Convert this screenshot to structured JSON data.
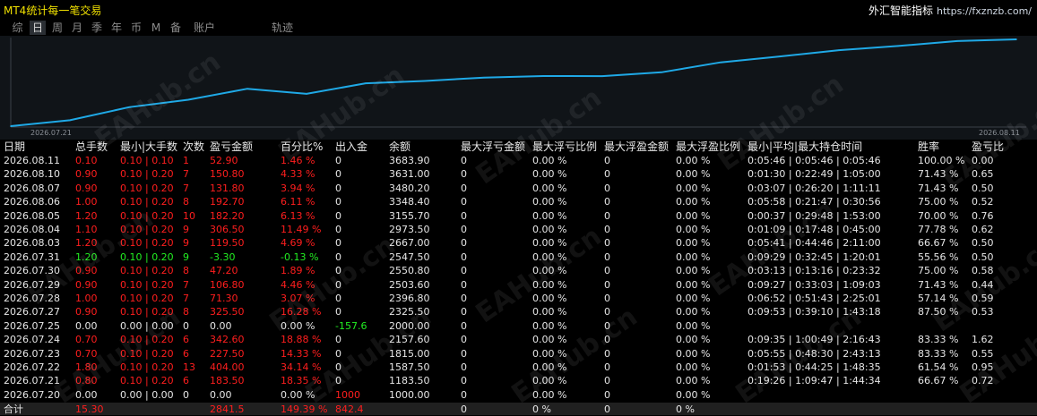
{
  "app": {
    "title": "MT4统计每一笔交易",
    "brand_name": "外汇智能指标",
    "brand_url": "https://fxznzb.com/"
  },
  "tabs": [
    {
      "label": "综",
      "active": false
    },
    {
      "label": "日",
      "active": true
    },
    {
      "label": "周",
      "active": false
    },
    {
      "label": "月",
      "active": false
    },
    {
      "label": "季",
      "active": false
    },
    {
      "label": "年",
      "active": false
    },
    {
      "label": "币",
      "active": false
    },
    {
      "label": "M",
      "active": false
    },
    {
      "label": "备",
      "active": false
    },
    {
      "label": "账户",
      "active": false
    },
    {
      "label": "轨迹",
      "active": false
    }
  ],
  "colors": {
    "loss": "#ff1e1e",
    "profit": "#22ee22",
    "neutral": "#e6e6e6",
    "line": "#1fa9e6",
    "title": "#f0e000"
  },
  "watermark": "EAHub.cn",
  "chart_data": {
    "type": "line",
    "x_start_label": "2026.07.21",
    "x_end_label": "2026.08.11",
    "series": [
      {
        "values": [
          1000.0,
          1183.5,
          1587.5,
          1815.0,
          2157.6,
          2000.0,
          2325.5,
          2396.8,
          2503.6,
          2550.8,
          2547.5,
          2667.0,
          2973.5,
          3155.7,
          3348.4,
          3480.2,
          3631.0,
          3683.9
        ]
      }
    ],
    "ylim": [
      1000.0,
      3683.9
    ]
  },
  "table": {
    "headers": [
      "日期",
      "总手数",
      "最小|大手数",
      "次数",
      "盈亏金额",
      "百分比%",
      "出入金",
      "余额",
      "最大浮亏金额",
      "最大浮亏比例",
      "最大浮盈金额",
      "最大浮盈比例",
      "最小|平均|最大持仓时间",
      "胜率",
      "盈亏比"
    ],
    "rows": [
      {
        "date": "2026.08.11",
        "lots": "0.10",
        "minmax": "0.10 | 0.10",
        "count": "1",
        "pnl": "52.90",
        "pct": "1.46 %",
        "flow": "0",
        "balance": "3683.90",
        "fl_amt": "0",
        "fl_pct": "0.00 %",
        "fp_amt": "0",
        "fp_pct": "0.00 %",
        "time": "0:05:46 | 0:05:46 | 0:05:46",
        "win": "100.00 %",
        "rr": "0.00",
        "color": "red",
        "flow_color": "white"
      },
      {
        "date": "2026.08.10",
        "lots": "0.90",
        "minmax": "0.10 | 0.20",
        "count": "7",
        "pnl": "150.80",
        "pct": "4.33 %",
        "flow": "0",
        "balance": "3631.00",
        "fl_amt": "0",
        "fl_pct": "0.00 %",
        "fp_amt": "0",
        "fp_pct": "0.00 %",
        "time": "0:01:30 | 0:22:49 | 1:05:00",
        "win": "71.43 %",
        "rr": "0.65",
        "color": "red",
        "flow_color": "white"
      },
      {
        "date": "2026.08.07",
        "lots": "0.90",
        "minmax": "0.10 | 0.20",
        "count": "7",
        "pnl": "131.80",
        "pct": "3.94 %",
        "flow": "0",
        "balance": "3480.20",
        "fl_amt": "0",
        "fl_pct": "0.00 %",
        "fp_amt": "0",
        "fp_pct": "0.00 %",
        "time": "0:03:07 | 0:26:20 | 1:11:11",
        "win": "71.43 %",
        "rr": "0.50",
        "color": "red",
        "flow_color": "white"
      },
      {
        "date": "2026.08.06",
        "lots": "1.00",
        "minmax": "0.10 | 0.20",
        "count": "8",
        "pnl": "192.70",
        "pct": "6.11 %",
        "flow": "0",
        "balance": "3348.40",
        "fl_amt": "0",
        "fl_pct": "0.00 %",
        "fp_amt": "0",
        "fp_pct": "0.00 %",
        "time": "0:05:58 | 0:21:47 | 0:30:56",
        "win": "75.00 %",
        "rr": "0.52",
        "color": "red",
        "flow_color": "white"
      },
      {
        "date": "2026.08.05",
        "lots": "1.20",
        "minmax": "0.10 | 0.20",
        "count": "10",
        "pnl": "182.20",
        "pct": "6.13 %",
        "flow": "0",
        "balance": "3155.70",
        "fl_amt": "0",
        "fl_pct": "0.00 %",
        "fp_amt": "0",
        "fp_pct": "0.00 %",
        "time": "0:00:37 | 0:29:48 | 1:53:00",
        "win": "70.00 %",
        "rr": "0.76",
        "color": "red",
        "flow_color": "white"
      },
      {
        "date": "2026.08.04",
        "lots": "1.10",
        "minmax": "0.10 | 0.20",
        "count": "9",
        "pnl": "306.50",
        "pct": "11.49 %",
        "flow": "0",
        "balance": "2973.50",
        "fl_amt": "0",
        "fl_pct": "0.00 %",
        "fp_amt": "0",
        "fp_pct": "0.00 %",
        "time": "0:01:09 | 0:17:48 | 0:45:00",
        "win": "77.78 %",
        "rr": "0.62",
        "color": "red",
        "flow_color": "white"
      },
      {
        "date": "2026.08.03",
        "lots": "1.20",
        "minmax": "0.10 | 0.20",
        "count": "9",
        "pnl": "119.50",
        "pct": "4.69 %",
        "flow": "0",
        "balance": "2667.00",
        "fl_amt": "0",
        "fl_pct": "0.00 %",
        "fp_amt": "0",
        "fp_pct": "0.00 %",
        "time": "0:05:41 | 0:44:46 | 2:11:00",
        "win": "66.67 %",
        "rr": "0.50",
        "color": "red",
        "flow_color": "white"
      },
      {
        "date": "2026.07.31",
        "lots": "1.20",
        "minmax": "0.10 | 0.20",
        "count": "9",
        "pnl": "-3.30",
        "pct": "-0.13 %",
        "flow": "0",
        "balance": "2547.50",
        "fl_amt": "0",
        "fl_pct": "0.00 %",
        "fp_amt": "0",
        "fp_pct": "0.00 %",
        "time": "0:09:29 | 0:32:45 | 1:20:01",
        "win": "55.56 %",
        "rr": "0.50",
        "color": "green",
        "flow_color": "white"
      },
      {
        "date": "2026.07.30",
        "lots": "0.90",
        "minmax": "0.10 | 0.20",
        "count": "8",
        "pnl": "47.20",
        "pct": "1.89 %",
        "flow": "0",
        "balance": "2550.80",
        "fl_amt": "0",
        "fl_pct": "0.00 %",
        "fp_amt": "0",
        "fp_pct": "0.00 %",
        "time": "0:03:13 | 0:13:16 | 0:23:32",
        "win": "75.00 %",
        "rr": "0.58",
        "color": "red",
        "flow_color": "white"
      },
      {
        "date": "2026.07.29",
        "lots": "0.90",
        "minmax": "0.10 | 0.20",
        "count": "7",
        "pnl": "106.80",
        "pct": "4.46 %",
        "flow": "0",
        "balance": "2503.60",
        "fl_amt": "0",
        "fl_pct": "0.00 %",
        "fp_amt": "0",
        "fp_pct": "0.00 %",
        "time": "0:09:27 | 0:33:03 | 1:09:03",
        "win": "71.43 %",
        "rr": "0.44",
        "color": "red",
        "flow_color": "white"
      },
      {
        "date": "2026.07.28",
        "lots": "1.00",
        "minmax": "0.10 | 0.20",
        "count": "7",
        "pnl": "71.30",
        "pct": "3.07 %",
        "flow": "0",
        "balance": "2396.80",
        "fl_amt": "0",
        "fl_pct": "0.00 %",
        "fp_amt": "0",
        "fp_pct": "0.00 %",
        "time": "0:06:52 | 0:51:43 | 2:25:01",
        "win": "57.14 %",
        "rr": "0.59",
        "color": "red",
        "flow_color": "white"
      },
      {
        "date": "2026.07.27",
        "lots": "0.90",
        "minmax": "0.10 | 0.20",
        "count": "8",
        "pnl": "325.50",
        "pct": "16.28 %",
        "flow": "0",
        "balance": "2325.50",
        "fl_amt": "0",
        "fl_pct": "0.00 %",
        "fp_amt": "0",
        "fp_pct": "0.00 %",
        "time": "0:09:53 | 0:39:10 | 1:43:18",
        "win": "87.50 %",
        "rr": "0.53",
        "color": "red",
        "flow_color": "white"
      },
      {
        "date": "2026.07.25",
        "lots": "0.00",
        "minmax": "0.00 | 0.00",
        "count": "0",
        "pnl": "0.00",
        "pct": "0.00 %",
        "flow": "-157.6",
        "balance": "2000.00",
        "fl_amt": "0",
        "fl_pct": "0.00 %",
        "fp_amt": "0",
        "fp_pct": "0.00 %",
        "time": "",
        "win": "",
        "rr": "",
        "color": "white",
        "flow_color": "green"
      },
      {
        "date": "2026.07.24",
        "lots": "0.70",
        "minmax": "0.10 | 0.20",
        "count": "6",
        "pnl": "342.60",
        "pct": "18.88 %",
        "flow": "0",
        "balance": "2157.60",
        "fl_amt": "0",
        "fl_pct": "0.00 %",
        "fp_amt": "0",
        "fp_pct": "0.00 %",
        "time": "0:09:35 | 1:00:49 | 2:16:43",
        "win": "83.33 %",
        "rr": "1.62",
        "color": "red",
        "flow_color": "white"
      },
      {
        "date": "2026.07.23",
        "lots": "0.70",
        "minmax": "0.10 | 0.20",
        "count": "6",
        "pnl": "227.50",
        "pct": "14.33 %",
        "flow": "0",
        "balance": "1815.00",
        "fl_amt": "0",
        "fl_pct": "0.00 %",
        "fp_amt": "0",
        "fp_pct": "0.00 %",
        "time": "0:05:55 | 0:48:30 | 2:43:13",
        "win": "83.33 %",
        "rr": "0.55",
        "color": "red",
        "flow_color": "white"
      },
      {
        "date": "2026.07.22",
        "lots": "1.80",
        "minmax": "0.10 | 0.20",
        "count": "13",
        "pnl": "404.00",
        "pct": "34.14 %",
        "flow": "0",
        "balance": "1587.50",
        "fl_amt": "0",
        "fl_pct": "0.00 %",
        "fp_amt": "0",
        "fp_pct": "0.00 %",
        "time": "0:01:53 | 0:44:25 | 1:48:35",
        "win": "61.54 %",
        "rr": "0.95",
        "color": "red",
        "flow_color": "white"
      },
      {
        "date": "2026.07.21",
        "lots": "0.80",
        "minmax": "0.10 | 0.20",
        "count": "6",
        "pnl": "183.50",
        "pct": "18.35 %",
        "flow": "0",
        "balance": "1183.50",
        "fl_amt": "0",
        "fl_pct": "0.00 %",
        "fp_amt": "0",
        "fp_pct": "0.00 %",
        "time": "0:19:26 | 1:09:47 | 1:44:34",
        "win": "66.67 %",
        "rr": "0.72",
        "color": "red",
        "flow_color": "white"
      },
      {
        "date": "2026.07.20",
        "lots": "0.00",
        "minmax": "0.00 | 0.00",
        "count": "0",
        "pnl": "0.00",
        "pct": "0.00 %",
        "flow": "1000",
        "balance": "1000.00",
        "fl_amt": "0",
        "fl_pct": "0.00 %",
        "fp_amt": "0",
        "fp_pct": "0.00 %",
        "time": "",
        "win": "",
        "rr": "",
        "color": "white",
        "flow_color": "red"
      }
    ],
    "total": {
      "label": "合计",
      "lots": "15.30",
      "pnl": "2841.5",
      "pct": "149.39 %",
      "flow": "842.4",
      "fl_amt": "0",
      "fl_pct": "0 %",
      "fp_amt": "0",
      "fp_pct": "0 %"
    }
  }
}
